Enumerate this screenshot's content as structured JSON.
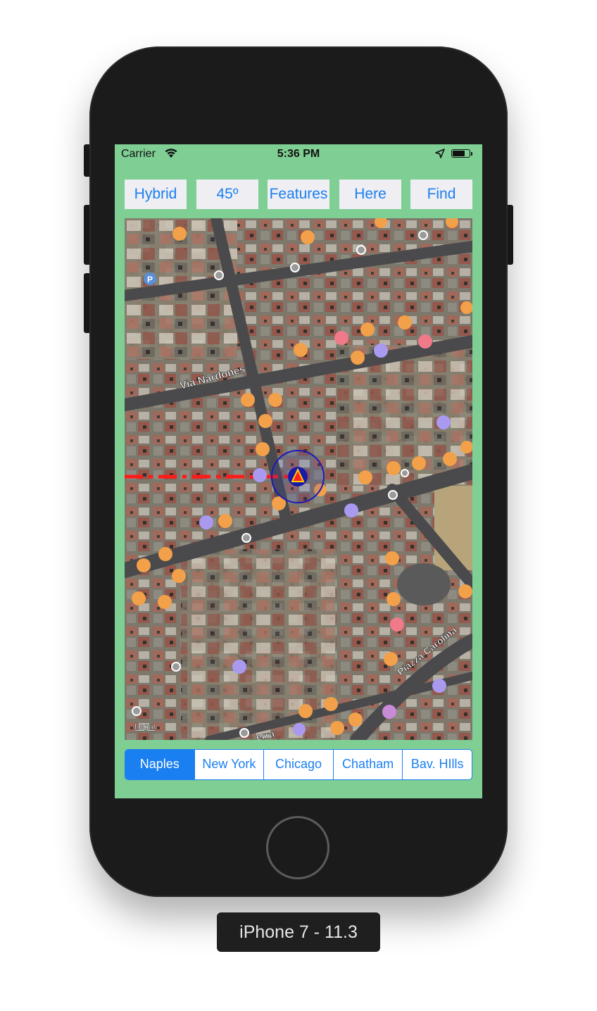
{
  "status_bar": {
    "carrier": "Carrier",
    "time": "5:36 PM",
    "battery_level": 0.75
  },
  "toolbar": {
    "buttons": [
      {
        "label": "Hybrid"
      },
      {
        "label": "45º"
      },
      {
        "label": "Features"
      },
      {
        "label": "Here"
      },
      {
        "label": "Find"
      }
    ]
  },
  "map": {
    "style": "hybrid satellite",
    "street_labels": [
      "Via Nardones",
      "Piazza Carolina",
      "erra"
    ],
    "legal_label": "Legal",
    "route_line_color": "#ff1a1a",
    "user_marker_color": "#1a1aa8",
    "poi_colors": {
      "restaurant": "#f2a04a",
      "hotel": "#a99af0",
      "dentist": "#f07a8a",
      "parking": "#5a8fd8",
      "shop": "#f2a04a",
      "generic": "#8a8a8a"
    }
  },
  "segmented_control": {
    "items": [
      {
        "label": "Naples",
        "selected": true
      },
      {
        "label": "New York",
        "selected": false
      },
      {
        "label": "Chicago",
        "selected": false
      },
      {
        "label": "Chatham",
        "selected": false
      },
      {
        "label": "Bav. HIlls",
        "selected": false
      }
    ]
  },
  "device_label": "iPhone 7 - 11.3",
  "colors": {
    "screen_background": "#7fcf94",
    "tint": "#1a7ff0",
    "button_background": "#eeeef3"
  }
}
